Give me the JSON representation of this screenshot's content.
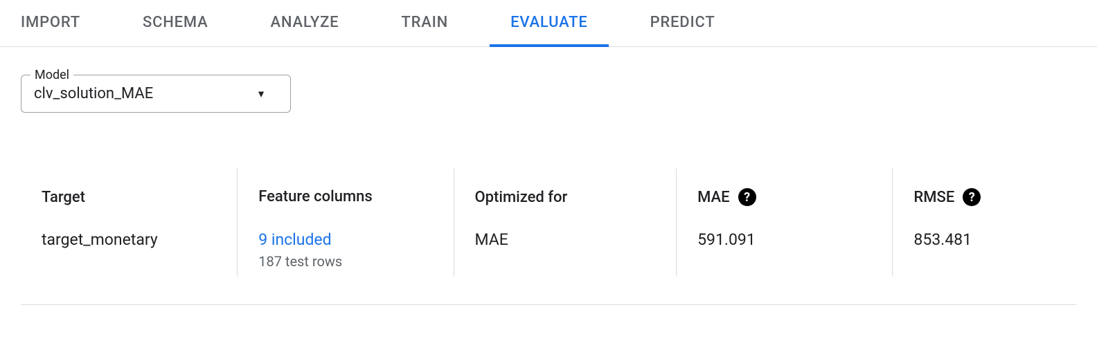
{
  "tabs": {
    "import": "IMPORT",
    "schema": "SCHEMA",
    "analyze": "ANALYZE",
    "train": "TRAIN",
    "evaluate": "EVALUATE",
    "predict": "PREDICT"
  },
  "model": {
    "label": "Model",
    "selected": "clv_solution_MAE"
  },
  "metrics": {
    "target": {
      "header": "Target",
      "value": "target_monetary"
    },
    "feature_columns": {
      "header": "Feature columns",
      "link": "9 included",
      "sub": "187 test rows"
    },
    "optimized_for": {
      "header": "Optimized for",
      "value": "MAE"
    },
    "mae": {
      "header": "MAE",
      "value": "591.091"
    },
    "rmse": {
      "header": "RMSE",
      "value": "853.481"
    }
  }
}
